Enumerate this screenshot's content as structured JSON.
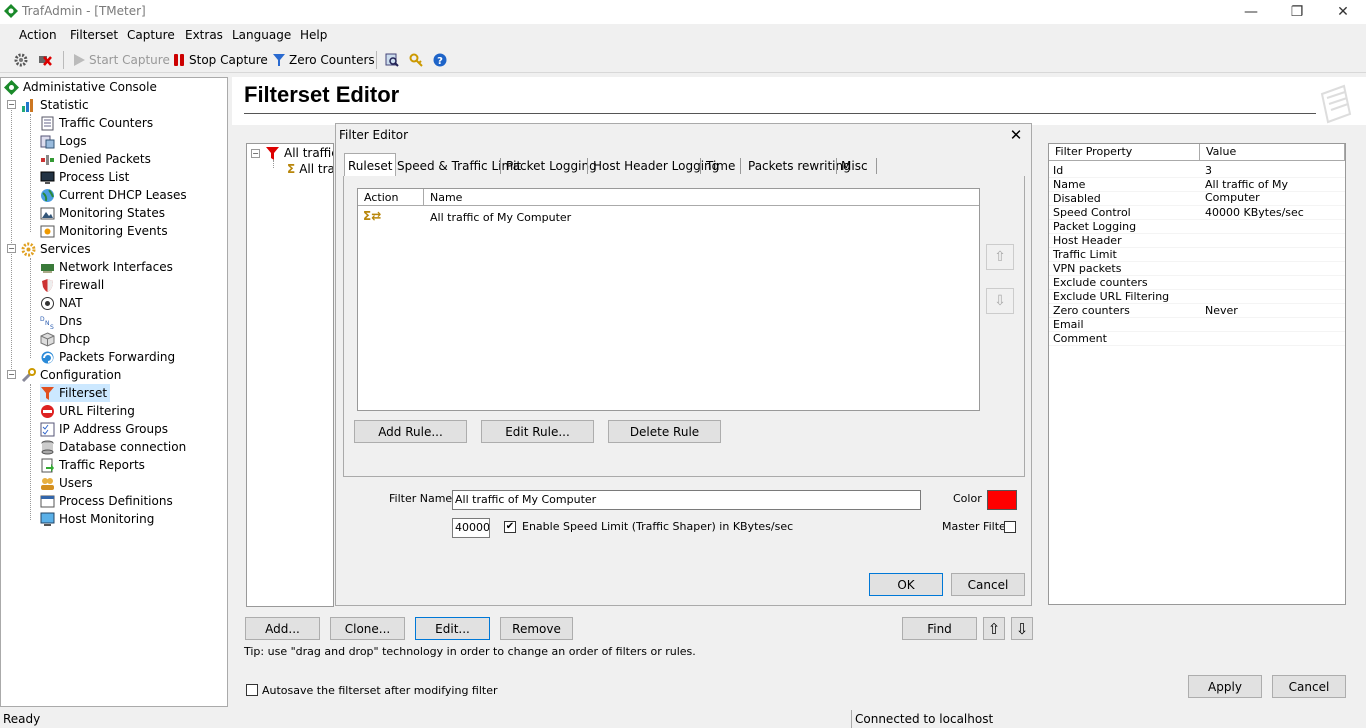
{
  "window": {
    "title": "TrafAdmin - [TMeter]",
    "minimize": "—",
    "restore": "❐",
    "close": "✕"
  },
  "menu": [
    "Action",
    "Filterset",
    "Capture",
    "Extras",
    "Language",
    "Help"
  ],
  "toolbar": {
    "start_capture": "Start Capture",
    "stop_capture": "Stop Capture",
    "zero_counters": "Zero Counters"
  },
  "tree": {
    "root": "Administative Console",
    "statistic": {
      "label": "Statistic",
      "items": [
        "Traffic Counters",
        "Logs",
        "Denied Packets",
        "Process List",
        "Current DHCP Leases",
        "Monitoring States",
        "Monitoring Events"
      ]
    },
    "services": {
      "label": "Services",
      "items": [
        "Network Interfaces",
        "Firewall",
        "NAT",
        "Dns",
        "Dhcp",
        "Packets Forwarding"
      ]
    },
    "configuration": {
      "label": "Configuration",
      "items": [
        "Filterset",
        "URL Filtering",
        "IP Address Groups",
        "Database connection",
        "Traffic Reports",
        "Users",
        "Process Definitions",
        "Host Monitoring"
      ]
    }
  },
  "editor": {
    "title": "Filterset Editor",
    "filter_tree": {
      "filter": "All traffic o",
      "rule": "All traf"
    },
    "buttons": {
      "add": "Add...",
      "clone": "Clone...",
      "edit": "Edit...",
      "remove": "Remove",
      "find": "Find",
      "up": "⇧",
      "down": "⇩",
      "apply": "Apply",
      "cancel": "Cancel"
    },
    "tip": "Tip: use \"drag and drop\" technology in order to change an order of filters or rules.",
    "autosave": "Autosave the filterset after modifying filter"
  },
  "properties": {
    "col_property": "Filter Property",
    "col_value": "Value",
    "rows": [
      {
        "name": "Id",
        "value": "3"
      },
      {
        "name": "Name",
        "value": "All traffic of My Computer"
      },
      {
        "name": "Disabled",
        "value": ""
      },
      {
        "name": "Speed Control",
        "value": "40000 KBytes/sec"
      },
      {
        "name": "Packet Logging",
        "value": ""
      },
      {
        "name": "Host Header",
        "value": ""
      },
      {
        "name": "Traffic Limit",
        "value": ""
      },
      {
        "name": "VPN packets",
        "value": ""
      },
      {
        "name": "Exclude counters",
        "value": ""
      },
      {
        "name": "Exclude URL Filtering",
        "value": ""
      },
      {
        "name": "Zero counters",
        "value": "Never"
      },
      {
        "name": "Email",
        "value": ""
      },
      {
        "name": "Comment",
        "value": ""
      }
    ]
  },
  "dialog": {
    "title": "Filter Editor",
    "close": "✕",
    "tabs": [
      "Ruleset",
      "Speed & Traffic Limit",
      "Packet Logging",
      "Host Header Logging",
      "Time",
      "Packets rewriting",
      "Misc"
    ],
    "rules": {
      "col_action": "Action",
      "col_name": "Name",
      "row": {
        "action": "Σ⇄",
        "name": "All traffic of My Computer"
      }
    },
    "rule_buttons": {
      "add": "Add Rule...",
      "edit": "Edit Rule...",
      "delete": "Delete Rule"
    },
    "move_up": "⇧",
    "move_down": "⇩",
    "filter_name_label": "Filter Name",
    "filter_name_value": "All traffic of My Computer",
    "color_label": "Color",
    "color_value": "#ff0000",
    "speed_value": "40000",
    "speed_check": "✔",
    "speed_label": "Enable Speed Limit (Traffic Shaper) in KBytes/sec",
    "master_filter": "Master Filter",
    "ok": "OK",
    "cancel": "Cancel"
  },
  "status": {
    "left": "Ready",
    "right": "Connected to localhost"
  }
}
